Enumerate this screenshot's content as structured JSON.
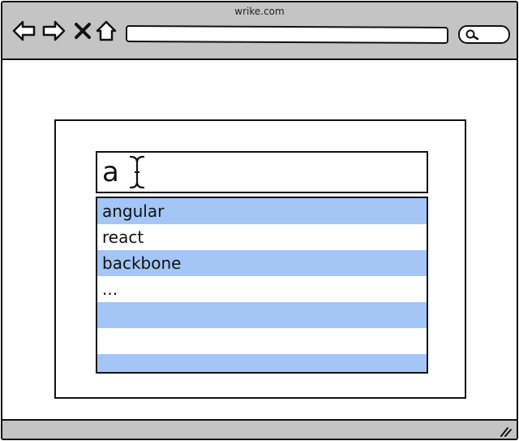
{
  "browser": {
    "title": "wrike.com",
    "nav_icons": [
      "back-arrow-icon",
      "forward-arrow-icon",
      "close-x-icon",
      "home-icon"
    ],
    "address_value": "",
    "search_icon": "magnifier-icon"
  },
  "autocomplete": {
    "input_value": "a",
    "suggestions": [
      {
        "label": "angular",
        "highlighted": true
      },
      {
        "label": "react",
        "highlighted": false
      },
      {
        "label": "backbone",
        "highlighted": true
      },
      {
        "label": "...",
        "highlighted": false
      },
      {
        "label": "",
        "highlighted": true
      },
      {
        "label": "",
        "highlighted": false
      },
      {
        "label": "",
        "highlighted": true
      }
    ]
  },
  "colors": {
    "chrome_gray": "#c4c4c4",
    "highlight_blue": "#a3c6f7",
    "stroke": "#111111"
  }
}
